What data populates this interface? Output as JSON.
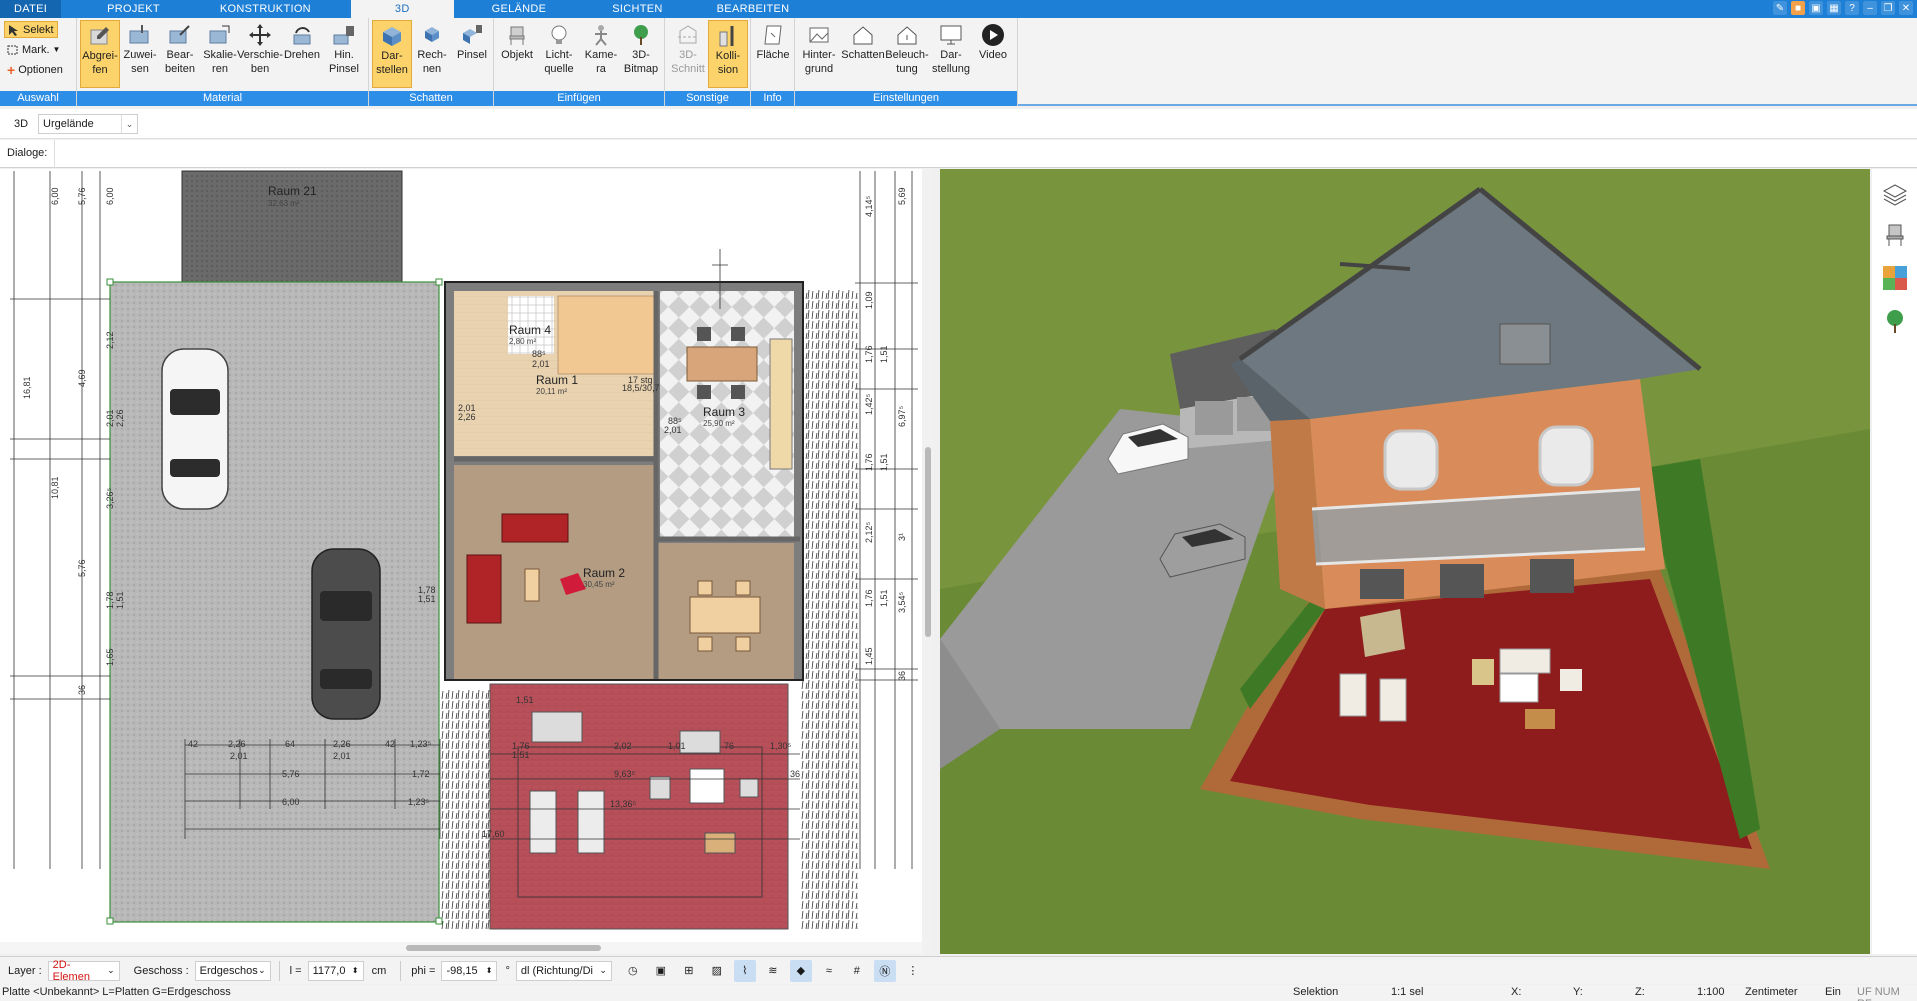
{
  "menubar": {
    "tabs": [
      "DATEI",
      "PROJEKT",
      "KONSTRUKTION",
      "3D",
      "GELÄNDE",
      "SICHTEN",
      "BEARBEITEN"
    ],
    "active": "3D"
  },
  "ribbon": {
    "auswahl": {
      "caption": "Auswahl",
      "items": [
        "Selekt",
        "Mark.",
        "Optionen"
      ]
    },
    "material": {
      "caption": "Material",
      "buttons": [
        "Abgrei-\nfen",
        "Zuwei-\nsen",
        "Bear-\nbeiten",
        "Skalie-\nren",
        "Verschie-\nben",
        "Drehen",
        "Hin.\nPinsel"
      ]
    },
    "schatten": {
      "caption": "Schatten",
      "buttons": [
        "Dar-\nstellen",
        "Rech-\nnen",
        "Pinsel"
      ]
    },
    "einfuegen": {
      "caption": "Einfügen",
      "buttons": [
        "Objekt",
        "Licht-\nquelle",
        "Kame-\nra",
        "3D-\nBitmap"
      ]
    },
    "sonstige": {
      "caption": "Sonstige",
      "buttons": [
        "3D-\nSchnitt",
        "Kolli-\nsion"
      ]
    },
    "info": {
      "caption": "Info",
      "buttons": [
        "Fläche"
      ]
    },
    "einstellungen": {
      "caption": "Einstellungen",
      "buttons": [
        "Hinter-\ngrund",
        "Schatten",
        "Beleuch-\ntung",
        "Dar-\nstellung",
        "Video"
      ]
    }
  },
  "viewrow": {
    "tag": "3D",
    "terrain": "Urgelände"
  },
  "dialogrow": {
    "label": "Dialoge:"
  },
  "plan": {
    "rooms": [
      {
        "name": "Raum 21",
        "area": "32,63 m²"
      },
      {
        "name": "Raum 4",
        "area": "2,80 m²"
      },
      {
        "name": "Raum 1",
        "area": "20,11 m²"
      },
      {
        "name": "Raum 3",
        "area": "25,90 m²"
      },
      {
        "name": "Raum 2",
        "area": "30,45 m²"
      }
    ],
    "dims_top": [
      "42",
      "2,26",
      "64",
      "2,26",
      "42",
      "1,23⁵"
    ],
    "dims_row2": [
      "2,01",
      "2,01"
    ],
    "dims_row3": [
      "5,76",
      "1,72"
    ],
    "dims_row4": [
      "6,00",
      "1,23⁵"
    ],
    "dims_terrace": [
      "1,76",
      "1,51",
      "2,02",
      "1,01",
      "76",
      "1,30⁵",
      "9,63⁵",
      "13,36⁵",
      "17,60",
      "1,51",
      "36"
    ],
    "dims_left": [
      "6,00",
      "5,76",
      "6,00",
      "16,81",
      "10,81",
      "4,69",
      "5,76",
      "2,12",
      "2,01",
      "2,26",
      "3,26⁵",
      "1,78",
      "1,51",
      "1,65",
      "36"
    ],
    "dims_right": [
      "4,14⁵",
      "5,69",
      "1,09",
      "1,76",
      "1,51",
      "6,97⁵",
      "1,42⁵",
      "1,76",
      "1,51",
      "2,12⁵",
      "3¹",
      "1,76",
      "1,51",
      "3,54⁵",
      "1,45",
      "36"
    ],
    "dims_inner": [
      "2,01",
      "2,26",
      "88⁵",
      "2,01",
      "88⁵",
      "2,01",
      "17 stg",
      "18,5/30,7",
      "1,78",
      "1,51"
    ]
  },
  "toolbar": {
    "layer_label": "Layer :",
    "layer_value": "2D-Elemen",
    "geschoss_label": "Geschoss :",
    "geschoss_value": "Erdgeschos",
    "l_label": "l =",
    "l_value": "1177,0",
    "l_unit": "cm",
    "phi_label": "phi =",
    "phi_value": "-98,15",
    "phi_unit": "°",
    "mode_value": "dl (Richtung/Di"
  },
  "statusbar": {
    "left": "Platte <Unbekannt> L=Platten G=Erdgeschoss",
    "selektion": "Selektion",
    "sel_count": "1:1 sel",
    "x": "X:",
    "y": "Y:",
    "z": "Z:",
    "scale": "1:100",
    "unit": "Zentimeter",
    "ein": "Ein",
    "flags": "UF NUM RF"
  },
  "colors": {
    "accent": "#1e7fd6",
    "ribbon_caption": "#2d8ee8",
    "active_button": "#fbd36a",
    "layer_red": "#d41515"
  }
}
